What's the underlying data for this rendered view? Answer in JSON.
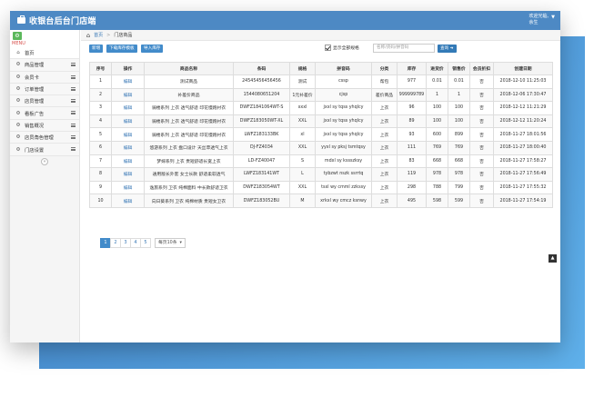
{
  "app": {
    "title": "收银台后台门店端",
    "logo_icon": "briefcase-icon"
  },
  "user": {
    "greeting": "欢迎光临,",
    "name": "余生"
  },
  "sidebar": {
    "toggle_icon": "gear-icon",
    "menu_label": "MENU",
    "items": [
      {
        "label": "首页",
        "icon": "home-icon"
      },
      {
        "label": "商品管理",
        "icon": "cogs-icon"
      },
      {
        "label": "会员卡",
        "icon": "cogs-icon"
      },
      {
        "label": "订单管理",
        "icon": "cogs-icon"
      },
      {
        "label": "店员管理",
        "icon": "cogs-icon"
      },
      {
        "label": "看板广告",
        "icon": "cogs-icon"
      },
      {
        "label": "销售概况",
        "icon": "cogs-icon"
      },
      {
        "label": "店员角色管理",
        "icon": "cogs-icon"
      },
      {
        "label": "门店设置",
        "icon": "cogs-icon"
      }
    ],
    "collapse_glyph": "«"
  },
  "breadcrumb": {
    "home": "首页",
    "separator": ">",
    "current": "门店商品"
  },
  "toolbar": {
    "add": "新增",
    "download_template": "下载库存模板",
    "import_stock": "导入库存",
    "checkbox_label": "显示全部规格",
    "search_placeholder": "名称/货码/拼音码",
    "search_button": "查询"
  },
  "table": {
    "headers": [
      "序号",
      "操作",
      "商品名称",
      "条码",
      "规格",
      "拼音码",
      "分类",
      "库存",
      "进货价",
      "销售价",
      "会员折扣",
      "创建日期"
    ],
    "rows": [
      [
        "1",
        "编辑",
        "测试商品",
        "24545456456456",
        "测试",
        "cssp",
        "帮包",
        "977",
        "0.01",
        "0.01",
        "否",
        "2018-12-10 11:25:03"
      ],
      [
        "2",
        "编辑",
        "补差价商品",
        "1544080651204",
        "1元补差价",
        "cjsp",
        "差价商品",
        "999999789",
        "1",
        "1",
        "否",
        "2018-12-06 17:30:47"
      ],
      [
        "3",
        "编辑",
        "骑楼系列 上衣 透气舒适 印花慢跑衬衣",
        "DWFZ1841064WT-S",
        "xxxl",
        "jxxl sy tqss yhqlcy",
        "上衣",
        "96",
        "100",
        "100",
        "否",
        "2018-12-12 11:21:29"
      ],
      [
        "4",
        "编辑",
        "骑楼系列 上衣 透气舒适 印花慢跑衬衣",
        "DWFZ183050WT-XL",
        "XXL",
        "jxxl sy tqss yhqlcy",
        "上衣",
        "89",
        "100",
        "100",
        "否",
        "2018-12-12 11:20:24"
      ],
      [
        "5",
        "编辑",
        "骑楼系列 上衣 透气舒适 印花慢跑衬衣",
        "LWFZ183133BK",
        "xl",
        "jxxl sy tqss yhqlcy",
        "上衣",
        "93",
        "600",
        "899",
        "否",
        "2018-11-27 18:01:56"
      ],
      [
        "6",
        "编辑",
        "悠游系列 上衣 盘口设计 天丝苹透气上衣",
        "DJ-FZ4034",
        "XXL",
        "yyxl sy pksj tsmtqsy",
        "上衣",
        "111",
        "769",
        "769",
        "否",
        "2018-11-27 18:00:40"
      ],
      [
        "7",
        "编辑",
        "梦嫁系列 上衣 贵短舒适长宽上衣",
        "LD-FZ40047",
        "S",
        "mdxl sy kssszksy",
        "上衣",
        "83",
        "668",
        "668",
        "否",
        "2018-11-27 17:58:27"
      ],
      [
        "8",
        "编辑",
        "通用版长外套 女士长款 舒适柔软透气",
        "LWFZ183141WT",
        "L",
        "tybzwt nszk ssrrtq",
        "上衣",
        "119",
        "978",
        "978",
        "否",
        "2018-11-27 17:56:49"
      ],
      [
        "9",
        "编辑",
        "逸旅系列 卫衣 纯棉面料 中长款舒适卫衣",
        "DWFZ183054WT",
        "XXL",
        "tsxl wy cmml zzkssy",
        "上衣",
        "298",
        "788",
        "799",
        "否",
        "2018-11-27 17:55:32"
      ],
      [
        "10",
        "编辑",
        "向日葵系列 卫衣 纯棉材质 贵短女卫衣",
        "DWFZ183052BU",
        "M",
        "xrkxl wy cmcz ksnwy",
        "上衣",
        "495",
        "598",
        "599",
        "否",
        "2018-11-27 17:54:19"
      ]
    ]
  },
  "pagination": {
    "pages": [
      "1",
      "2",
      "3",
      "4",
      "5"
    ],
    "current": "1",
    "per_page": "每页10条"
  },
  "colors": {
    "topbar": "#4d89c4",
    "primary": "#428bca",
    "backdrop_start": "#3f7fc4",
    "backdrop_end": "#5fb0ea"
  }
}
